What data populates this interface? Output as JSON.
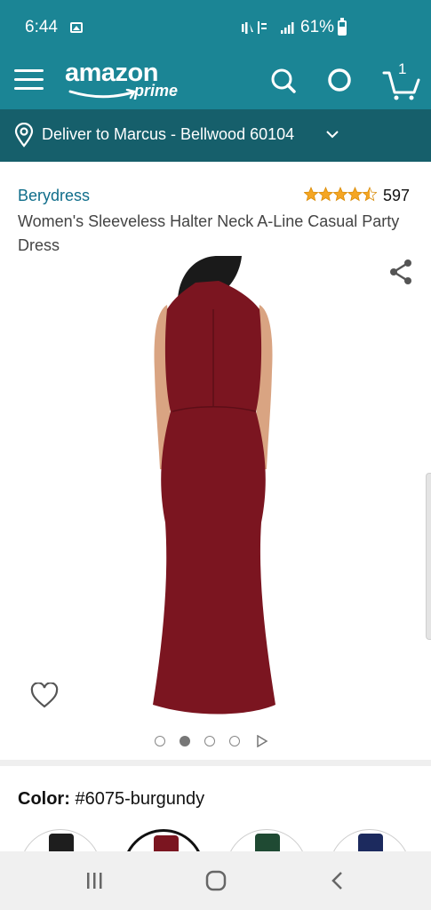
{
  "status_bar": {
    "time": "6:44",
    "battery": "61%",
    "icons": [
      "image-icon",
      "mute-icon",
      "data-icon",
      "signal-icon",
      "battery-icon"
    ]
  },
  "header": {
    "logo_word": "amazon",
    "logo_sub": "prime",
    "cart_count": "1",
    "icons": [
      "menu-icon",
      "search-icon",
      "alexa-icon",
      "cart-icon"
    ]
  },
  "delivery": {
    "text": "Deliver to Marcus - Bellwood 60104"
  },
  "product": {
    "brand": "Berydress",
    "rating": 4.5,
    "review_count": "597",
    "title": "Women's Sleeveless Halter Neck A-Line Casual Party Dress",
    "image_dress_color": "#7b1520",
    "image_count": 4,
    "active_image": 2
  },
  "color": {
    "label": "Color:",
    "value": "#6075-burgundy",
    "swatches": [
      {
        "name": "black",
        "hex": "#1e1e1e",
        "selected": false
      },
      {
        "name": "burgundy",
        "hex": "#7b1520",
        "selected": true
      },
      {
        "name": "green",
        "hex": "#1f4a33",
        "selected": false
      },
      {
        "name": "navy",
        "hex": "#1c2a5e",
        "selected": false
      }
    ]
  },
  "colors": {
    "brand_teal": "#1b8595",
    "deliver_bar": "#165f6b",
    "link": "#0f6d8a",
    "star": "#f5a623"
  }
}
